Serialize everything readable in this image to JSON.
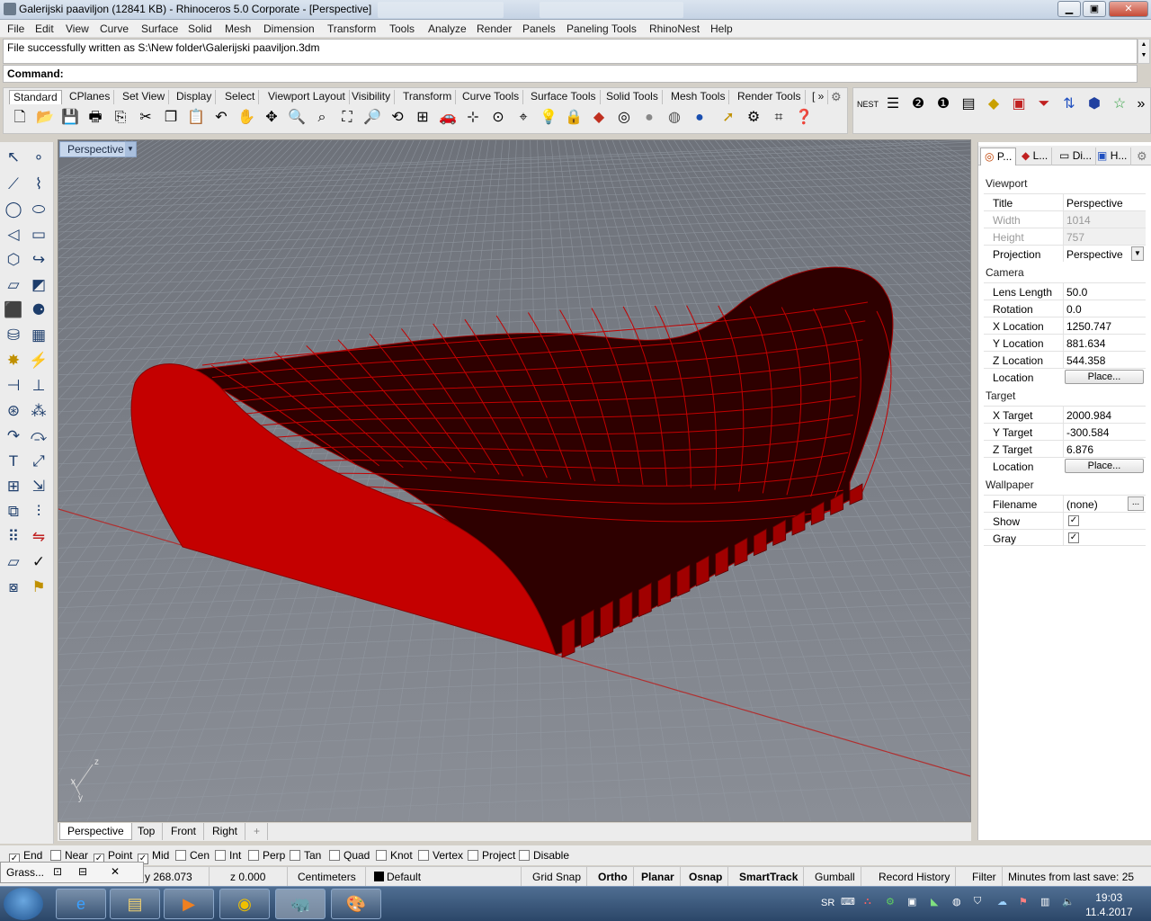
{
  "window": {
    "title": "Galerijski paaviljon (12841 KB) - Rhinoceros  5.0 Corporate - [Perspective]",
    "minimize": "▁",
    "maximize": "▣",
    "close": "✕"
  },
  "menu": [
    "File",
    "Edit",
    "View",
    "Curve",
    "Surface",
    "Solid",
    "Mesh",
    "Dimension",
    "Transform",
    "Tools",
    "Analyze",
    "Render",
    "Panels",
    "Paneling Tools",
    "RhinoNest",
    "Help"
  ],
  "command": {
    "history": "File successfully written as S:\\New folder\\Galerijski paaviljon.3dm",
    "prompt_label": "Command:",
    "value": ""
  },
  "toolbar_tabs": [
    "Standard",
    "CPlanes",
    "Set View",
    "Display",
    "Select",
    "Viewport Layout",
    "Visibility",
    "Transform",
    "Curve Tools",
    "Surface Tools",
    "Solid Tools",
    "Mesh Tools",
    "Render Tools",
    "[ »"
  ],
  "toolbar_icons": [
    "new-icon",
    "open-icon",
    "save-icon",
    "print-icon",
    "import-icon",
    "cut-icon",
    "copy-icon",
    "paste-icon",
    "undo-icon",
    "pan-icon",
    "rotate-view-icon",
    "zoom-icon",
    "zoom-window-icon",
    "zoom-extents-icon",
    "zoom-selected-icon",
    "rotate-camera-icon",
    "four-viewports-icon",
    "car-icon",
    "named-views-icon",
    "set-cplane-icon",
    "lightbulb-icon",
    "lock-icon",
    "layers-icon",
    "color-wheel-icon",
    "shaded-sphere-icon",
    "rendered-sphere-icon",
    "blue-sphere-icon",
    "mouse-pointer-icon",
    "gear-options-icon",
    "grid-options-icon",
    "help-icon"
  ],
  "viewport": {
    "title": "Perspective",
    "axis_labels": {
      "z": "z",
      "x": "x",
      "y": "y"
    }
  },
  "viewport_tabs": [
    "Perspective",
    "Top",
    "Front",
    "Right",
    "+"
  ],
  "panel": {
    "tabs": [
      "P...",
      "L...",
      "Di...",
      "H..."
    ],
    "sections": {
      "viewport": "Viewport",
      "camera": "Camera",
      "target": "Target",
      "wallpaper": "Wallpaper"
    },
    "viewport_rows": [
      {
        "key": "Title",
        "value": "Perspective"
      },
      {
        "key": "Width",
        "value": "1014"
      },
      {
        "key": "Height",
        "value": "757"
      },
      {
        "key": "Projection",
        "value": "Perspective"
      }
    ],
    "camera_rows": [
      {
        "key": "Lens Length",
        "value": "50.0"
      },
      {
        "key": "Rotation",
        "value": "0.0"
      },
      {
        "key": "X Location",
        "value": "1250.747"
      },
      {
        "key": "Y Location",
        "value": "881.634"
      },
      {
        "key": "Z Location",
        "value": "544.358"
      },
      {
        "key": "Location",
        "value": "Place..."
      }
    ],
    "target_rows": [
      {
        "key": "X Target",
        "value": "2000.984"
      },
      {
        "key": "Y Target",
        "value": "-300.584"
      },
      {
        "key": "Z Target",
        "value": "6.876"
      },
      {
        "key": "Location",
        "value": "Place..."
      }
    ],
    "wallpaper_rows": [
      {
        "key": "Filename",
        "value": "(none)",
        "button": "..."
      },
      {
        "key": "Show",
        "checked": true
      },
      {
        "key": "Gray",
        "checked": true
      }
    ]
  },
  "osnaps": [
    {
      "label": "End",
      "checked": true
    },
    {
      "label": "Near",
      "checked": false
    },
    {
      "label": "Point",
      "checked": true
    },
    {
      "label": "Mid",
      "checked": true
    },
    {
      "label": "Cen",
      "checked": false
    },
    {
      "label": "Int",
      "checked": false
    },
    {
      "label": "Perp",
      "checked": false
    },
    {
      "label": "Tan",
      "checked": false
    },
    {
      "label": "Quad",
      "checked": false
    },
    {
      "label": "Knot",
      "checked": false
    },
    {
      "label": "Vertex",
      "checked": false
    },
    {
      "label": "Project",
      "checked": false
    },
    {
      "label": "Disable",
      "checked": false
    }
  ],
  "grasshopper": {
    "label": "Grass...",
    "buttons": [
      "⊡",
      "⊟",
      "✕"
    ]
  },
  "status": {
    "y": "y 268.073",
    "z": "z 0.000",
    "units": "Centimeters",
    "layer": "Default",
    "toggles": [
      {
        "label": "Grid Snap",
        "on": false
      },
      {
        "label": "Ortho",
        "on": true
      },
      {
        "label": "Planar",
        "on": true
      },
      {
        "label": "Osnap",
        "on": true
      },
      {
        "label": "SmartTrack",
        "on": true
      },
      {
        "label": "Gumball",
        "on": false
      },
      {
        "label": "Record History",
        "on": false
      },
      {
        "label": "Filter",
        "on": false
      }
    ],
    "save_msg": "Minutes from last save: 25"
  },
  "taskbar": {
    "lang": "SR",
    "time": "19:03",
    "date": "11.4.2017"
  },
  "colors": {
    "model_red": "#c00000",
    "model_dark": "#3a0000",
    "viewport_bg": "#7d8189",
    "grid": "#8f939b",
    "x_axis": "#b03030"
  }
}
